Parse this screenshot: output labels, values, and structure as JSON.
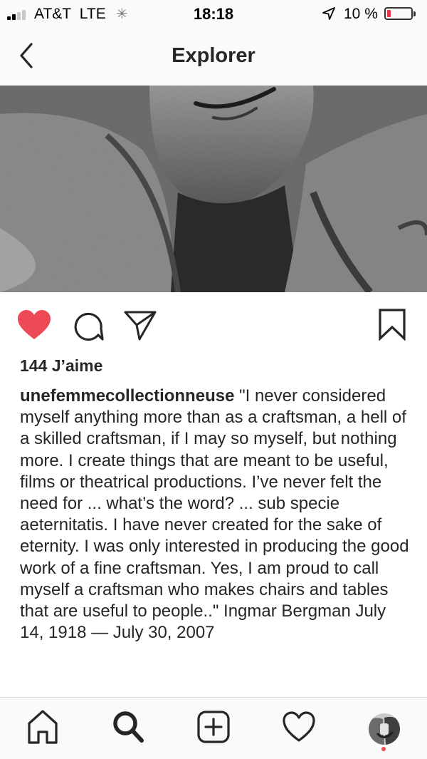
{
  "status_bar": {
    "carrier": "AT&T",
    "network": "LTE",
    "time": "18:18",
    "battery_percent": "10 %",
    "signal_bars_active": 2,
    "signal_bars_total": 4,
    "battery_level": 0.1,
    "battery_color": "#e8344a"
  },
  "header": {
    "title": "Explorer",
    "back_icon": "chevron-left-icon"
  },
  "post": {
    "image": "black-and-white-portrait",
    "liked": true,
    "like_color": "#ed4956",
    "likes_label": "144 J’aime",
    "username": "unefemmecollectionneuse",
    "caption": "\"I never considered myself anything more than as a craftsman, a hell of a skilled craftsman, if I may so myself, but nothing more. I create things that are meant to be useful, films or theatrical productions. I’ve never felt the need for ... what’s the word? ... sub specie aeternitatis. I have never created for the sake of eternity. I was only interested in producing the good work of a fine craftsman. Yes, I am proud to call myself a craftsman who makes chairs and tables that are useful to people..\" Ingmar Bergman July 14, 1918 — July 30, 2007",
    "actions": {
      "like_icon": "heart-icon",
      "comment_icon": "comment-icon",
      "share_icon": "paper-plane-icon",
      "save_icon": "bookmark-icon"
    }
  },
  "tab_bar": {
    "items": [
      "home-icon",
      "search-icon",
      "add-post-icon",
      "activity-heart-icon",
      "profile-avatar"
    ],
    "active": "search-icon",
    "notification_color": "#ed4956"
  }
}
